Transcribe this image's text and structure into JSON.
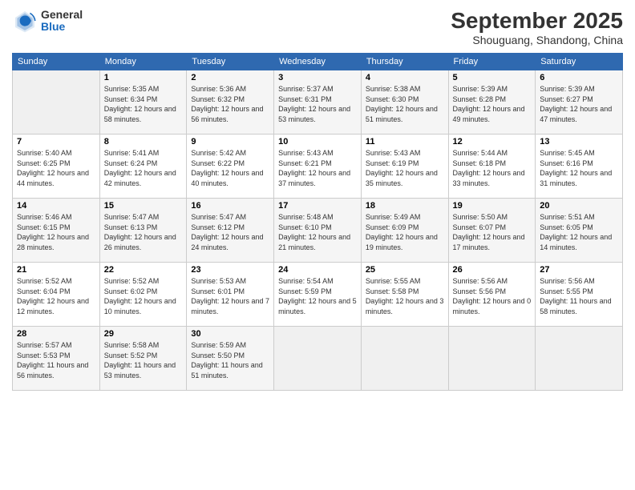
{
  "header": {
    "logo_general": "General",
    "logo_blue": "Blue",
    "title": "September 2025",
    "subtitle": "Shouguang, Shandong, China"
  },
  "days_of_week": [
    "Sunday",
    "Monday",
    "Tuesday",
    "Wednesday",
    "Thursday",
    "Friday",
    "Saturday"
  ],
  "weeks": [
    [
      {
        "day": "",
        "info": ""
      },
      {
        "day": "1",
        "info": "Sunrise: 5:35 AM\nSunset: 6:34 PM\nDaylight: 12 hours\nand 58 minutes."
      },
      {
        "day": "2",
        "info": "Sunrise: 5:36 AM\nSunset: 6:32 PM\nDaylight: 12 hours\nand 56 minutes."
      },
      {
        "day": "3",
        "info": "Sunrise: 5:37 AM\nSunset: 6:31 PM\nDaylight: 12 hours\nand 53 minutes."
      },
      {
        "day": "4",
        "info": "Sunrise: 5:38 AM\nSunset: 6:30 PM\nDaylight: 12 hours\nand 51 minutes."
      },
      {
        "day": "5",
        "info": "Sunrise: 5:39 AM\nSunset: 6:28 PM\nDaylight: 12 hours\nand 49 minutes."
      },
      {
        "day": "6",
        "info": "Sunrise: 5:39 AM\nSunset: 6:27 PM\nDaylight: 12 hours\nand 47 minutes."
      }
    ],
    [
      {
        "day": "7",
        "info": "Sunrise: 5:40 AM\nSunset: 6:25 PM\nDaylight: 12 hours\nand 44 minutes."
      },
      {
        "day": "8",
        "info": "Sunrise: 5:41 AM\nSunset: 6:24 PM\nDaylight: 12 hours\nand 42 minutes."
      },
      {
        "day": "9",
        "info": "Sunrise: 5:42 AM\nSunset: 6:22 PM\nDaylight: 12 hours\nand 40 minutes."
      },
      {
        "day": "10",
        "info": "Sunrise: 5:43 AM\nSunset: 6:21 PM\nDaylight: 12 hours\nand 37 minutes."
      },
      {
        "day": "11",
        "info": "Sunrise: 5:43 AM\nSunset: 6:19 PM\nDaylight: 12 hours\nand 35 minutes."
      },
      {
        "day": "12",
        "info": "Sunrise: 5:44 AM\nSunset: 6:18 PM\nDaylight: 12 hours\nand 33 minutes."
      },
      {
        "day": "13",
        "info": "Sunrise: 5:45 AM\nSunset: 6:16 PM\nDaylight: 12 hours\nand 31 minutes."
      }
    ],
    [
      {
        "day": "14",
        "info": "Sunrise: 5:46 AM\nSunset: 6:15 PM\nDaylight: 12 hours\nand 28 minutes."
      },
      {
        "day": "15",
        "info": "Sunrise: 5:47 AM\nSunset: 6:13 PM\nDaylight: 12 hours\nand 26 minutes."
      },
      {
        "day": "16",
        "info": "Sunrise: 5:47 AM\nSunset: 6:12 PM\nDaylight: 12 hours\nand 24 minutes."
      },
      {
        "day": "17",
        "info": "Sunrise: 5:48 AM\nSunset: 6:10 PM\nDaylight: 12 hours\nand 21 minutes."
      },
      {
        "day": "18",
        "info": "Sunrise: 5:49 AM\nSunset: 6:09 PM\nDaylight: 12 hours\nand 19 minutes."
      },
      {
        "day": "19",
        "info": "Sunrise: 5:50 AM\nSunset: 6:07 PM\nDaylight: 12 hours\nand 17 minutes."
      },
      {
        "day": "20",
        "info": "Sunrise: 5:51 AM\nSunset: 6:05 PM\nDaylight: 12 hours\nand 14 minutes."
      }
    ],
    [
      {
        "day": "21",
        "info": "Sunrise: 5:52 AM\nSunset: 6:04 PM\nDaylight: 12 hours\nand 12 minutes."
      },
      {
        "day": "22",
        "info": "Sunrise: 5:52 AM\nSunset: 6:02 PM\nDaylight: 12 hours\nand 10 minutes."
      },
      {
        "day": "23",
        "info": "Sunrise: 5:53 AM\nSunset: 6:01 PM\nDaylight: 12 hours\nand 7 minutes."
      },
      {
        "day": "24",
        "info": "Sunrise: 5:54 AM\nSunset: 5:59 PM\nDaylight: 12 hours\nand 5 minutes."
      },
      {
        "day": "25",
        "info": "Sunrise: 5:55 AM\nSunset: 5:58 PM\nDaylight: 12 hours\nand 3 minutes."
      },
      {
        "day": "26",
        "info": "Sunrise: 5:56 AM\nSunset: 5:56 PM\nDaylight: 12 hours\nand 0 minutes."
      },
      {
        "day": "27",
        "info": "Sunrise: 5:56 AM\nSunset: 5:55 PM\nDaylight: 11 hours\nand 58 minutes."
      }
    ],
    [
      {
        "day": "28",
        "info": "Sunrise: 5:57 AM\nSunset: 5:53 PM\nDaylight: 11 hours\nand 56 minutes."
      },
      {
        "day": "29",
        "info": "Sunrise: 5:58 AM\nSunset: 5:52 PM\nDaylight: 11 hours\nand 53 minutes."
      },
      {
        "day": "30",
        "info": "Sunrise: 5:59 AM\nSunset: 5:50 PM\nDaylight: 11 hours\nand 51 minutes."
      },
      {
        "day": "",
        "info": ""
      },
      {
        "day": "",
        "info": ""
      },
      {
        "day": "",
        "info": ""
      },
      {
        "day": "",
        "info": ""
      }
    ]
  ]
}
